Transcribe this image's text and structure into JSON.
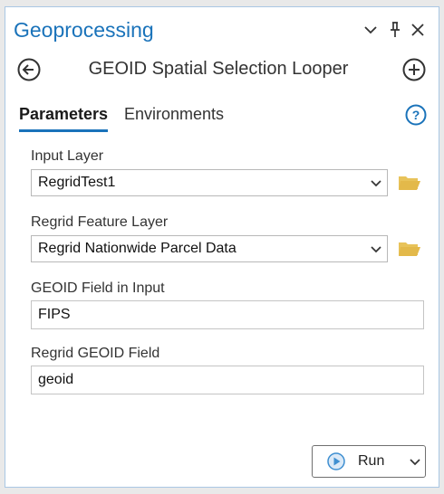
{
  "pane": {
    "title": "Geoprocessing",
    "controls": [
      "chevron-down-icon",
      "pin-icon",
      "close-icon"
    ]
  },
  "tool": {
    "name": "GEOID Spatial Selection Looper",
    "back_icon": "back-arrow-icon",
    "add_icon": "add-circle-icon"
  },
  "tabs": {
    "parameters": "Parameters",
    "environments": "Environments",
    "active": "Parameters",
    "help_icon": "help-icon"
  },
  "params": {
    "input_layer": {
      "label": "Input Layer",
      "value": "RegridTest1"
    },
    "regrid_feature_layer": {
      "label": "Regrid Feature Layer",
      "value": "Regrid Nationwide Parcel Data"
    },
    "geoid_field_input": {
      "label": "GEOID Field in Input",
      "value": "FIPS"
    },
    "regrid_geoid_field": {
      "label": "Regrid GEOID Field",
      "value": "geoid"
    }
  },
  "run": {
    "label": "Run"
  },
  "colors": {
    "accent": "#1a73ba",
    "folder": "#e3b94a",
    "run_icon": "#3f8fd1"
  }
}
